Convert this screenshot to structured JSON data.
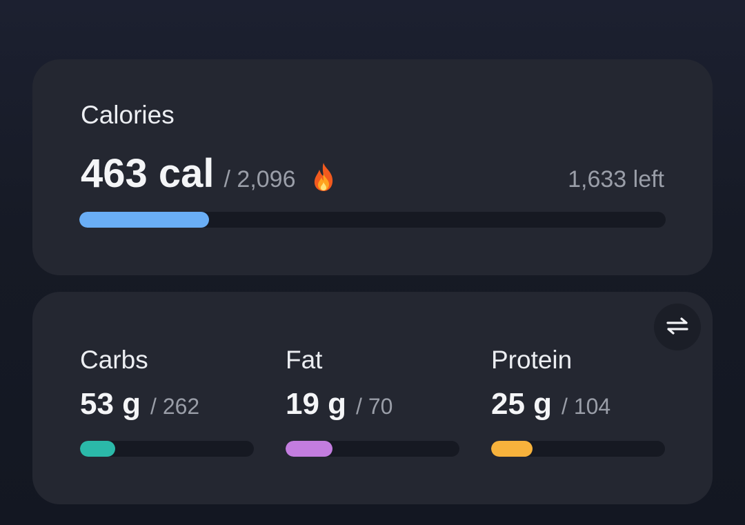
{
  "calories": {
    "title": "Calories",
    "value": "463 cal",
    "goal": "/ 2,096",
    "left": "1,633 left",
    "icon": "fire-icon",
    "progress": 0.221,
    "bar_color": "#6aaef5"
  },
  "macros": {
    "swap_icon": "swap-icon",
    "items": [
      {
        "name": "Carbs",
        "value": "53 g",
        "goal": "/ 262",
        "progress": 0.202,
        "color": "#2bb9a9"
      },
      {
        "name": "Fat",
        "value": "19 g",
        "goal": "/ 70",
        "progress": 0.271,
        "color": "#c37ddf"
      },
      {
        "name": "Protein",
        "value": "25 g",
        "goal": "/ 104",
        "progress": 0.24,
        "color": "#f7b23c"
      }
    ]
  }
}
